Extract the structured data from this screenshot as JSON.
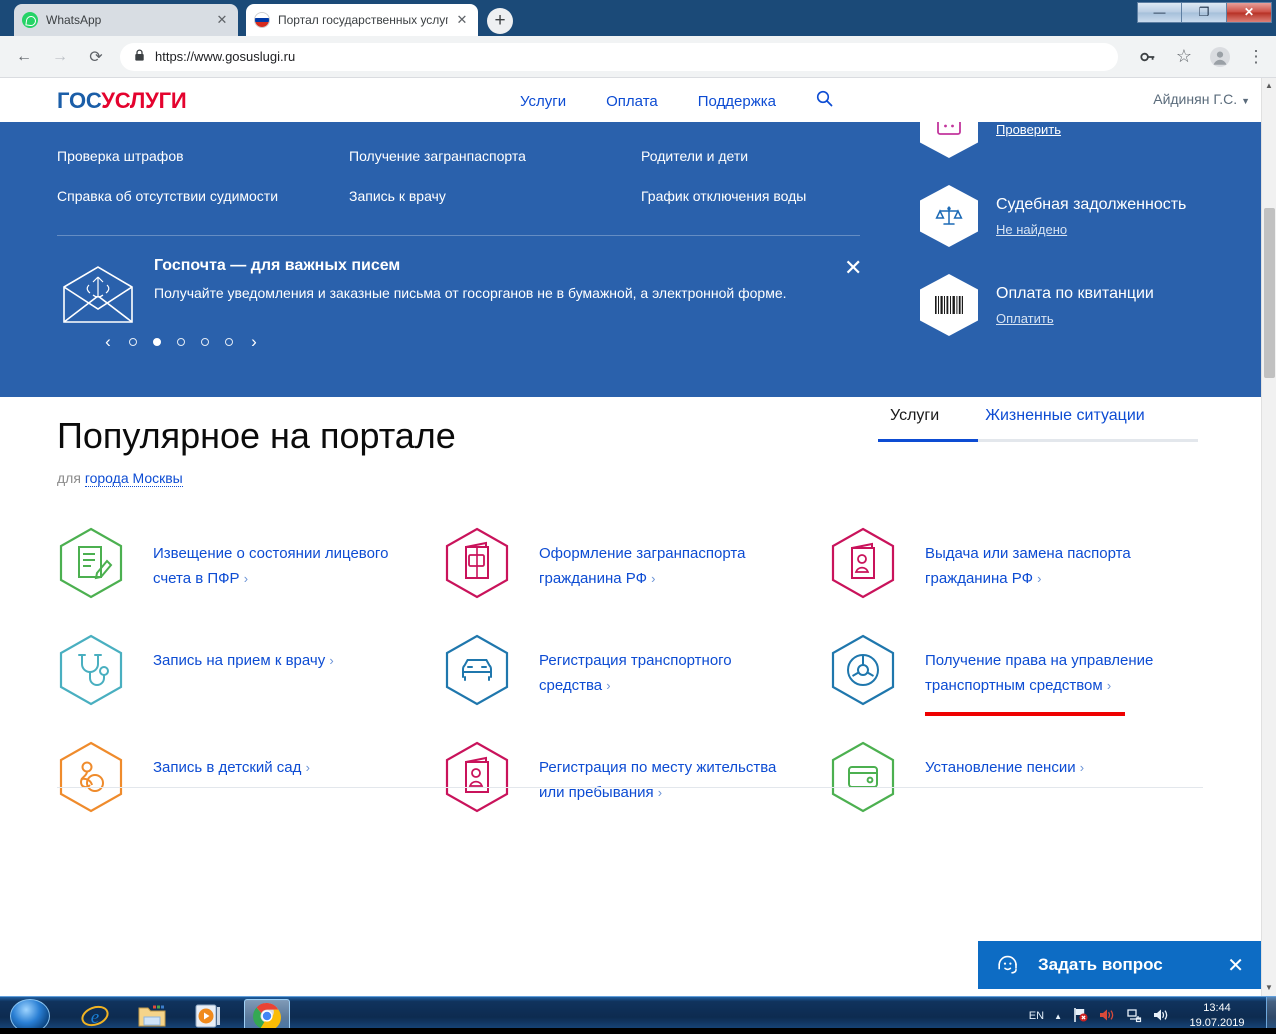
{
  "browser": {
    "tabs": [
      {
        "title": "WhatsApp",
        "favicon": "whatsapp-icon",
        "active": false,
        "close": "✕"
      },
      {
        "title": "Портал государственных услуг Р",
        "favicon": "russia-flag-icon",
        "active": true,
        "close": "✕"
      }
    ],
    "new_tab_label": "+",
    "window_buttons": {
      "minimize": "—",
      "maximize": "❐",
      "close": "✕"
    },
    "nav": {
      "back": "←",
      "forward": "→",
      "reload": "⟳"
    },
    "address": {
      "lock": "ὑ2",
      "url": "https://www.gosuslugi.ru"
    },
    "toolbar_right": {
      "key": "key-icon",
      "star": "☆",
      "profile": "profile-avatar",
      "menu": "⋮"
    }
  },
  "site": {
    "logo": {
      "part1": "ГОС",
      "part2": "УСЛУГИ"
    },
    "nav": [
      {
        "label": "Услуги"
      },
      {
        "label": "Оплата"
      },
      {
        "label": "Поддержка"
      }
    ],
    "search_icon": "search-icon",
    "user": {
      "name": "Айдинян Г.С.",
      "caret": "▼"
    }
  },
  "hero": {
    "quicklinks": [
      {
        "label": "Проверка штрафов"
      },
      {
        "label": "Получение загранпаспорта"
      },
      {
        "label": "Родители и дети"
      },
      {
        "label": "Справка об отсутствии судимости"
      },
      {
        "label": "Запись к врачу"
      },
      {
        "label": "График отключения воды"
      }
    ],
    "promo": {
      "title": "Госпочта — для важных писем",
      "subtitle": "Получайте уведомления и заказные письма от госорганов не в бумажной, а электронной форме.",
      "close": "✕",
      "icon": "envelope-coat-of-arms-icon"
    },
    "carousel": {
      "prev": "‹",
      "next": "›",
      "dots": 5,
      "active_dot": 2
    },
    "cards": [
      {
        "title": "",
        "link": "Проверить",
        "icon": "fines-card-icon",
        "clipped": true
      },
      {
        "title": "Судебная задолженность",
        "link": "Не найдено",
        "icon": "scales-icon",
        "clipped": false
      },
      {
        "title": "Оплата по квитанции",
        "link": "Оплатить",
        "icon": "barcode-icon",
        "clipped": false
      }
    ]
  },
  "popular": {
    "title": "Популярное на портале",
    "sub_prefix": "для",
    "sub_city": "города Москвы",
    "tabs": [
      {
        "label": "Услуги",
        "selected": true
      },
      {
        "label": "Жизненные ситуации",
        "selected": false
      }
    ],
    "tiles": [
      {
        "label": "Извещение о состоянии лицевого счета в ПФР",
        "chev": "›",
        "icon": "document-pen-icon",
        "color": "#4cb050",
        "highlighted": false
      },
      {
        "label": "Оформление загранпаспорта гражданина РФ",
        "chev": "›",
        "icon": "passport-icon",
        "color": "#c9135b",
        "highlighted": false
      },
      {
        "label": "Выдача или замена паспорта гражданина РФ",
        "chev": "›",
        "icon": "id-passport-icon",
        "color": "#c9135b",
        "highlighted": false
      },
      {
        "label": "Запись на прием к врачу",
        "chev": "›",
        "icon": "stethoscope-icon",
        "color": "#49afc0",
        "highlighted": false
      },
      {
        "label": "Регистрация транспортного средства",
        "chev": "›",
        "icon": "car-icon",
        "color": "#1f77ad",
        "highlighted": false
      },
      {
        "label": "Получение права на управление транспортным средством",
        "chev": "›",
        "icon": "steering-wheel-icon",
        "color": "#1f77ad",
        "highlighted": true
      },
      {
        "label": "Запись в детский сад",
        "chev": "›",
        "icon": "pacifier-icon",
        "color": "#ef8b2c",
        "highlighted": false
      },
      {
        "label": "Регистрация по месту жительства или пребывания",
        "chev": "›",
        "icon": "id-passport-icon",
        "color": "#c9135b",
        "highlighted": false
      },
      {
        "label": "Установление пенсии",
        "chev": "›",
        "icon": "wallet-icon",
        "color": "#4cb050",
        "highlighted": false
      }
    ]
  },
  "chat": {
    "label": "Задать вопрос",
    "close": "✕",
    "icon": "headset-smiley-icon"
  },
  "taskbar": {
    "start": "windows-start-orb",
    "items": [
      {
        "name": "internet-explorer-icon",
        "selected": false
      },
      {
        "name": "file-explorer-icon",
        "selected": false
      },
      {
        "name": "media-player-icon",
        "selected": false
      },
      {
        "name": "google-chrome-icon",
        "selected": true
      }
    ],
    "tray": {
      "language": "EN",
      "expand": "▲",
      "icons": [
        "flag-alert-icon",
        "volume-muted-icon",
        "network-icon",
        "volume-icon"
      ],
      "time": "13:44",
      "date": "19.07.2019"
    }
  },
  "colors": {
    "hero_blue": "#2a61ac",
    "link_blue": "#0d4cd3",
    "brand_red": "#e4032e",
    "highlight_red": "#ee0000",
    "chat_blue": "#0d6cc4"
  }
}
